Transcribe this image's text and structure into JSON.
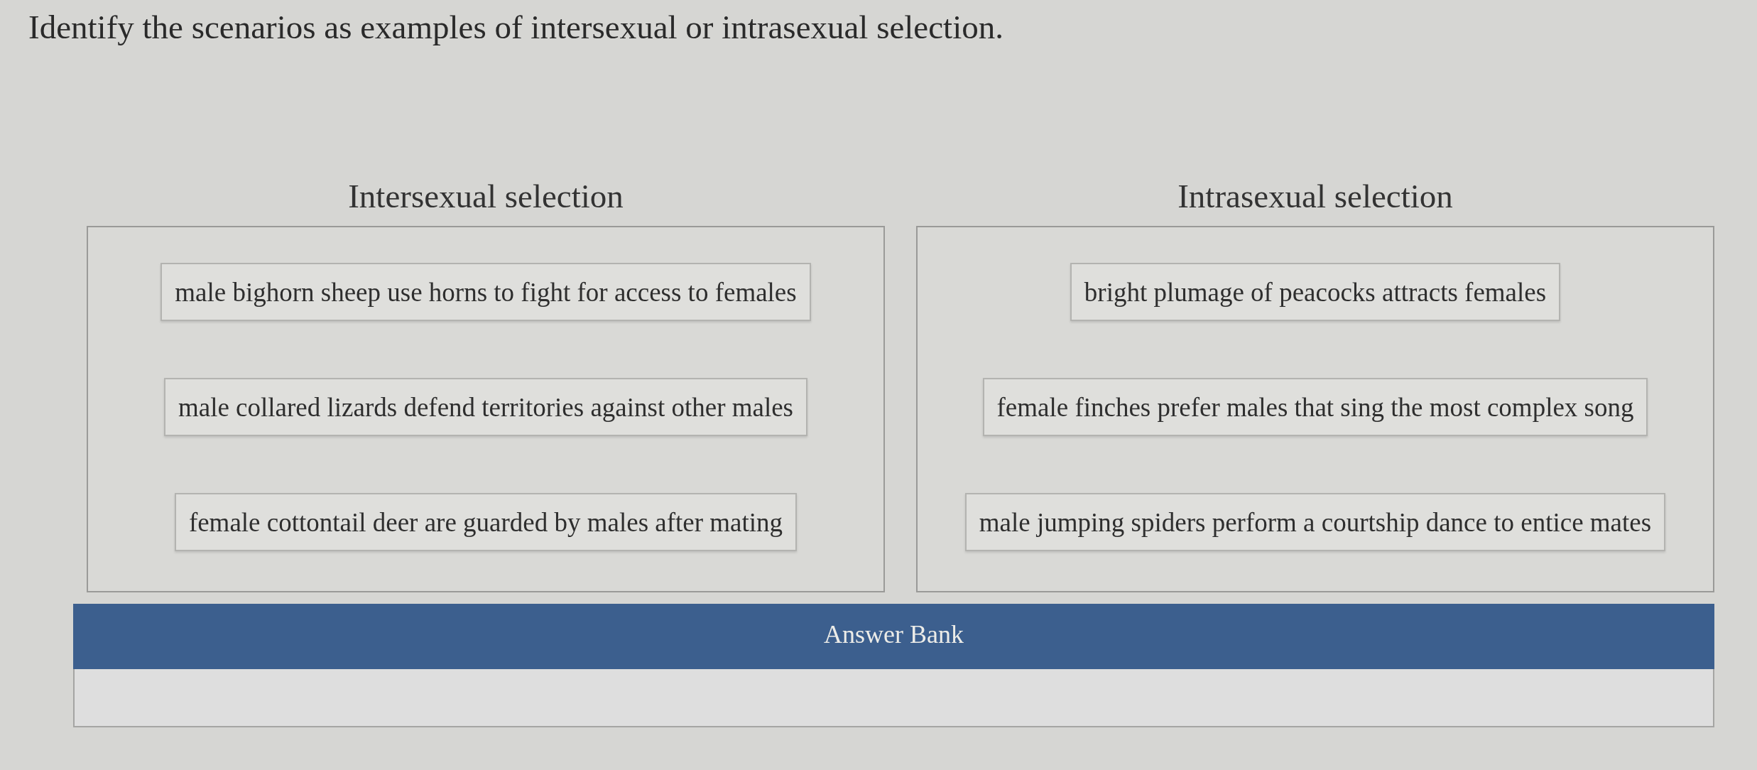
{
  "question": "Identify the scenarios as examples of intersexual or intrasexual selection.",
  "categories": [
    {
      "title": "Intersexual selection",
      "items": [
        "male bighorn sheep use horns to fight for access to females",
        "male collared lizards defend territories against other males",
        "female cottontail deer are guarded by males after mating"
      ]
    },
    {
      "title": "Intrasexual selection",
      "items": [
        "bright plumage of peacocks attracts females",
        "female finches prefer males that sing the most complex song",
        "male jumping spiders perform a courtship dance to entice mates"
      ]
    }
  ],
  "answer_bank": {
    "title": "Answer Bank"
  }
}
